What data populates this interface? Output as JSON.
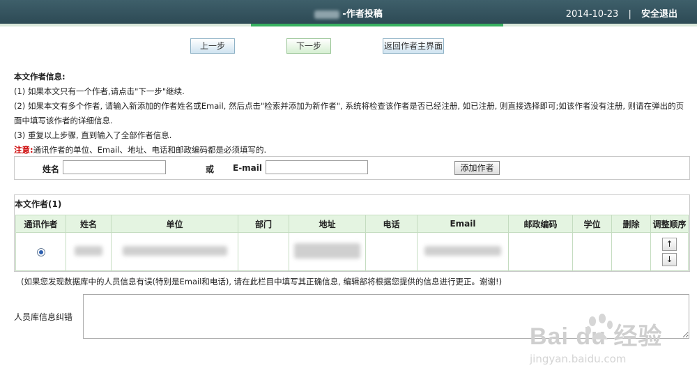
{
  "header": {
    "title": "-作者投稿",
    "date": "2014-10-23",
    "separator": "|",
    "logout": "安全退出"
  },
  "nav": {
    "prev": "上一步",
    "next": "下一步",
    "back_main": "返回作者主界面"
  },
  "info": {
    "heading": "本文作者信息:",
    "step1": "(1) 如果本文只有一个作者,请点击\"下一步\"继续.",
    "step2": "(2) 如果本文有多个作者, 请输入新添加的作者姓名或Email, 然后点击\"检索并添加为新作者\", 系统将检查该作者是否已经注册, 如已注册, 则直接选择即可;如该作者没有注册, 则请在弹出的页面中填写该作者的详细信息.",
    "step3": "(3) 重复以上步骤, 直到输入了全部作者信息.",
    "note_label": "注意:",
    "note_text": "通讯作者的单位、Email、地址、电话和邮政编码都是必须填写的."
  },
  "search": {
    "name_label": "姓名",
    "or_label": "或",
    "email_label": "E-mail",
    "name_value": "",
    "email_value": "",
    "add_button": "添加作者"
  },
  "authors": {
    "caption": "本文作者(1)",
    "columns": [
      "通讯作者",
      "姓名",
      "单位",
      "部门",
      "地址",
      "电话",
      "Email",
      "邮政编码",
      "学位",
      "删除",
      "调整顺序"
    ],
    "up_arrow": "↑",
    "down_arrow": "↓"
  },
  "correction": {
    "note": "(如果您发现数据库中的人员信息有误(特别是Email和电话), 请在此栏目中填写其正确信息, 编辑部将根据您提供的信息进行更正。谢谢!)",
    "label": "人员库信息纠错",
    "value": ""
  },
  "watermark": {
    "brand": "Bai du 经验",
    "site": "jingyan.baidu.com"
  }
}
